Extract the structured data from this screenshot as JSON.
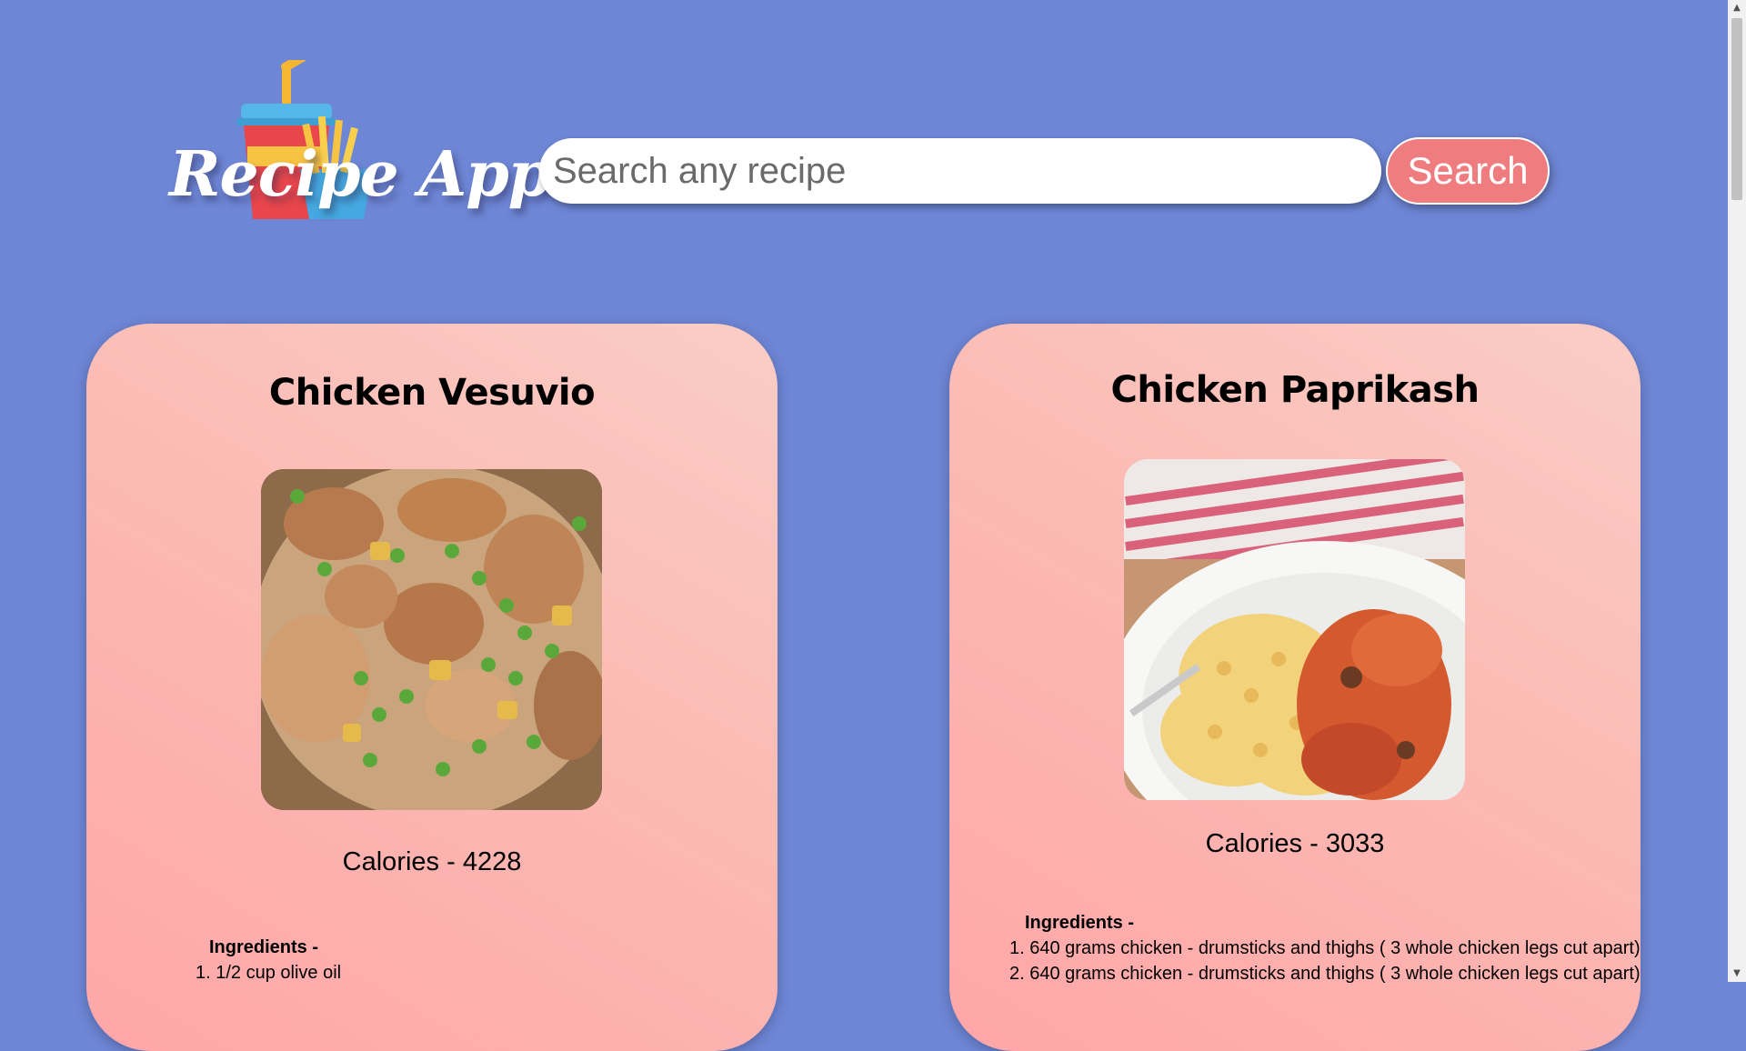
{
  "app": {
    "logo_text": "Recipe App"
  },
  "search": {
    "placeholder": "Search any recipe",
    "button_label": "Search"
  },
  "recipes": [
    {
      "title": "Chicken Vesuvio",
      "calories": "Calories - 4228",
      "ingredients_heading": "Ingredients -",
      "ingredients": [
        "1. 1/2 cup olive oil"
      ]
    },
    {
      "title": "Chicken Paprikash",
      "calories": "Calories - 3033",
      "ingredients_heading": "Ingredients -",
      "ingredients": [
        "1. 640 grams chicken - drumsticks and thighs ( 3 whole chicken legs cut apart)",
        "2. 640 grams chicken - drumsticks and thighs ( 3 whole chicken legs cut apart)"
      ]
    }
  ],
  "colors": {
    "background": "#6e86d6",
    "button": "#ef7d80",
    "card_gradient_start": "#ffa6a8",
    "card_gradient_end": "#facdc5"
  },
  "scrollbar": {
    "up_icon": "▲",
    "down_icon": "▼"
  }
}
